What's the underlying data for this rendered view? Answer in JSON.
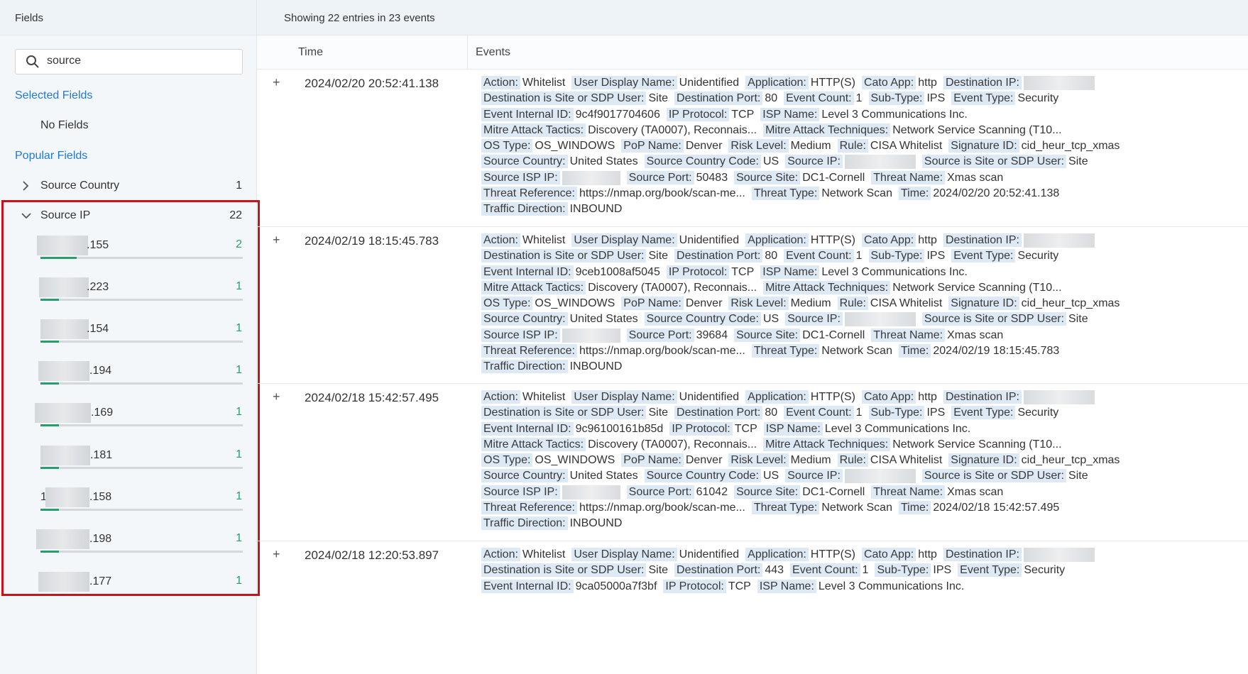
{
  "left_panel": {
    "header": "Fields",
    "search_value": "source",
    "selected_fields_title": "Selected Fields",
    "no_fields": "No Fields",
    "popular_fields_title": "Popular Fields",
    "fields": [
      {
        "name": "Source Country",
        "count": "1",
        "expanded": false
      },
      {
        "name": "Source IP",
        "count": "22",
        "expanded": true
      }
    ],
    "ip_values": [
      {
        "prefix": "1",
        "suffix": ".155",
        "count": "2",
        "fraction": 0.18
      },
      {
        "prefix": "",
        "suffix": ".223",
        "count": "1",
        "fraction": 0.09
      },
      {
        "prefix": "",
        "suffix": ".154",
        "count": "1",
        "fraction": 0.09
      },
      {
        "prefix": "",
        "suffix": ".194",
        "count": "1",
        "fraction": 0.09
      },
      {
        "prefix": "",
        "suffix": ".169",
        "count": "1",
        "fraction": 0.09
      },
      {
        "prefix": "",
        "suffix": ".181",
        "count": "1",
        "fraction": 0.09
      },
      {
        "prefix": "1",
        "suffix": ".158",
        "count": "1",
        "fraction": 0.09
      },
      {
        "prefix": "",
        "suffix": ".198",
        "count": "1",
        "fraction": 0.09
      },
      {
        "prefix": "",
        "suffix": ".177",
        "count": "1",
        "fraction": 0.09
      }
    ],
    "icons": {
      "search": "search-icon",
      "collapsed": "chevron-right-icon",
      "expanded": "chevron-down-icon"
    },
    "colors": {
      "accent_link": "#1f7ad6",
      "bar_fill": "#2a9d6c",
      "highlight_box": "#c4141c"
    }
  },
  "right_panel": {
    "summary": "Showing 22 entries in 23 events",
    "columns": {
      "time": "Time",
      "events": "Events"
    },
    "expand_symbol": "+",
    "events": [
      {
        "time": "2024/02/20 20:52:41.138",
        "lines": [
          [
            [
              "Action:",
              "Whitelist"
            ],
            [
              "User Display Name:",
              "Unidentified"
            ],
            [
              "Application:",
              "HTTP(S)"
            ],
            [
              "Cato App:",
              "http"
            ],
            [
              "Destination IP:",
              ""
            ]
          ],
          [
            [
              "Destination is Site or SDP User:",
              "Site"
            ],
            [
              "Destination Port:",
              "80"
            ],
            [
              "Event Count:",
              "1"
            ],
            [
              "Sub-Type:",
              "IPS"
            ],
            [
              "Event Type:",
              "Security"
            ]
          ],
          [
            [
              "Event Internal ID:",
              "9c4f9017704606"
            ],
            [
              "IP Protocol:",
              "TCP"
            ],
            [
              "ISP Name:",
              "Level 3 Communications Inc."
            ]
          ],
          [
            [
              "Mitre Attack Tactics:",
              "Discovery (TA0007), Reconnais..."
            ],
            [
              "Mitre Attack Techniques:",
              "Network Service Scanning (T10..."
            ]
          ],
          [
            [
              "OS Type:",
              "OS_WINDOWS"
            ],
            [
              "PoP Name:",
              "Denver"
            ],
            [
              "Risk Level:",
              "Medium"
            ],
            [
              "Rule:",
              "CISA Whitelist"
            ],
            [
              "Signature ID:",
              "cid_heur_tcp_xmas"
            ]
          ],
          [
            [
              "Source Country:",
              "United States"
            ],
            [
              "Source Country Code:",
              "US"
            ],
            [
              "Source IP:",
              ""
            ],
            [
              "Source is Site or SDP User:",
              "Site"
            ]
          ],
          [
            [
              "Source ISP IP:",
              ""
            ],
            [
              "Source Port:",
              "50483"
            ],
            [
              "Source Site:",
              "DC1-Cornell"
            ],
            [
              "Threat Name:",
              "Xmas scan"
            ]
          ],
          [
            [
              "Threat Reference:",
              "https://nmap.org/book/scan-me..."
            ],
            [
              "Threat Type:",
              "Network Scan"
            ],
            [
              "Time:",
              "2024/02/20 20:52:41.138"
            ]
          ],
          [
            [
              "Traffic Direction:",
              "INBOUND"
            ]
          ]
        ]
      },
      {
        "time": "2024/02/19 18:15:45.783",
        "lines": [
          [
            [
              "Action:",
              "Whitelist"
            ],
            [
              "User Display Name:",
              "Unidentified"
            ],
            [
              "Application:",
              "HTTP(S)"
            ],
            [
              "Cato App:",
              "http"
            ],
            [
              "Destination IP:",
              ""
            ]
          ],
          [
            [
              "Destination is Site or SDP User:",
              "Site"
            ],
            [
              "Destination Port:",
              "80"
            ],
            [
              "Event Count:",
              "1"
            ],
            [
              "Sub-Type:",
              "IPS"
            ],
            [
              "Event Type:",
              "Security"
            ]
          ],
          [
            [
              "Event Internal ID:",
              "9ceb1008af5045"
            ],
            [
              "IP Protocol:",
              "TCP"
            ],
            [
              "ISP Name:",
              "Level 3 Communications Inc."
            ]
          ],
          [
            [
              "Mitre Attack Tactics:",
              "Discovery (TA0007), Reconnais..."
            ],
            [
              "Mitre Attack Techniques:",
              "Network Service Scanning (T10..."
            ]
          ],
          [
            [
              "OS Type:",
              "OS_WINDOWS"
            ],
            [
              "PoP Name:",
              "Denver"
            ],
            [
              "Risk Level:",
              "Medium"
            ],
            [
              "Rule:",
              "CISA Whitelist"
            ],
            [
              "Signature ID:",
              "cid_heur_tcp_xmas"
            ]
          ],
          [
            [
              "Source Country:",
              "United States"
            ],
            [
              "Source Country Code:",
              "US"
            ],
            [
              "Source IP:",
              ""
            ],
            [
              "Source is Site or SDP User:",
              "Site"
            ]
          ],
          [
            [
              "Source ISP IP:",
              ""
            ],
            [
              "Source Port:",
              "39684"
            ],
            [
              "Source Site:",
              "DC1-Cornell"
            ],
            [
              "Threat Name:",
              "Xmas scan"
            ]
          ],
          [
            [
              "Threat Reference:",
              "https://nmap.org/book/scan-me..."
            ],
            [
              "Threat Type:",
              "Network Scan"
            ],
            [
              "Time:",
              "2024/02/19 18:15:45.783"
            ]
          ],
          [
            [
              "Traffic Direction:",
              "INBOUND"
            ]
          ]
        ]
      },
      {
        "time": "2024/02/18 15:42:57.495",
        "lines": [
          [
            [
              "Action:",
              "Whitelist"
            ],
            [
              "User Display Name:",
              "Unidentified"
            ],
            [
              "Application:",
              "HTTP(S)"
            ],
            [
              "Cato App:",
              "http"
            ],
            [
              "Destination IP:",
              ""
            ]
          ],
          [
            [
              "Destination is Site or SDP User:",
              "Site"
            ],
            [
              "Destination Port:",
              "80"
            ],
            [
              "Event Count:",
              "1"
            ],
            [
              "Sub-Type:",
              "IPS"
            ],
            [
              "Event Type:",
              "Security"
            ]
          ],
          [
            [
              "Event Internal ID:",
              "9c96100161b85d"
            ],
            [
              "IP Protocol:",
              "TCP"
            ],
            [
              "ISP Name:",
              "Level 3 Communications Inc."
            ]
          ],
          [
            [
              "Mitre Attack Tactics:",
              "Discovery (TA0007), Reconnais..."
            ],
            [
              "Mitre Attack Techniques:",
              "Network Service Scanning (T10..."
            ]
          ],
          [
            [
              "OS Type:",
              "OS_WINDOWS"
            ],
            [
              "PoP Name:",
              "Denver"
            ],
            [
              "Risk Level:",
              "Medium"
            ],
            [
              "Rule:",
              "CISA Whitelist"
            ],
            [
              "Signature ID:",
              "cid_heur_tcp_xmas"
            ]
          ],
          [
            [
              "Source Country:",
              "United States"
            ],
            [
              "Source Country Code:",
              "US"
            ],
            [
              "Source IP:",
              ""
            ],
            [
              "Source is Site or SDP User:",
              "Site"
            ]
          ],
          [
            [
              "Source ISP IP:",
              ""
            ],
            [
              "Source Port:",
              "61042"
            ],
            [
              "Source Site:",
              "DC1-Cornell"
            ],
            [
              "Threat Name:",
              "Xmas scan"
            ]
          ],
          [
            [
              "Threat Reference:",
              "https://nmap.org/book/scan-me..."
            ],
            [
              "Threat Type:",
              "Network Scan"
            ],
            [
              "Time:",
              "2024/02/18 15:42:57.495"
            ]
          ],
          [
            [
              "Traffic Direction:",
              "INBOUND"
            ]
          ]
        ]
      },
      {
        "time": "2024/02/18 12:20:53.897",
        "lines": [
          [
            [
              "Action:",
              "Whitelist"
            ],
            [
              "User Display Name:",
              "Unidentified"
            ],
            [
              "Application:",
              "HTTP(S)"
            ],
            [
              "Cato App:",
              "http"
            ],
            [
              "Destination IP:",
              ""
            ]
          ],
          [
            [
              "Destination is Site or SDP User:",
              "Site"
            ],
            [
              "Destination Port:",
              "443"
            ],
            [
              "Event Count:",
              "1"
            ],
            [
              "Sub-Type:",
              "IPS"
            ],
            [
              "Event Type:",
              "Security"
            ]
          ],
          [
            [
              "Event Internal ID:",
              "9ca05000a7f3bf"
            ],
            [
              "IP Protocol:",
              "TCP"
            ],
            [
              "ISP Name:",
              "Level 3 Communications Inc."
            ]
          ]
        ]
      }
    ]
  }
}
